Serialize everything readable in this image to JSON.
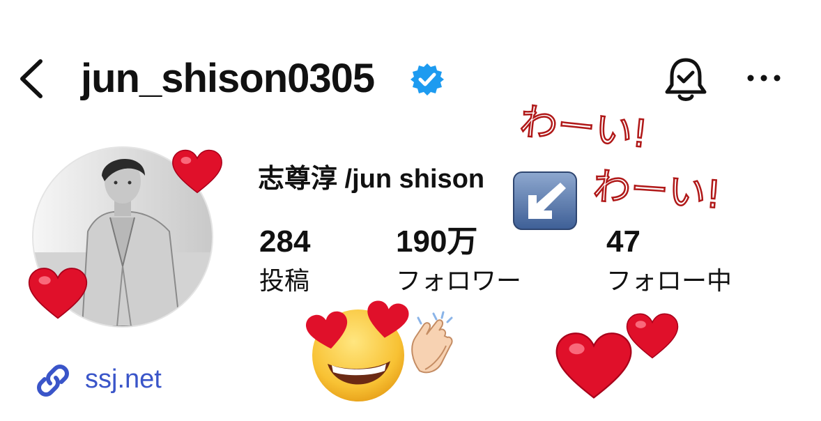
{
  "header": {
    "username": "jun_shison0305"
  },
  "profile": {
    "full_name": "志尊淳 /jun shison",
    "stats": {
      "posts": {
        "count": "284",
        "label": "投稿"
      },
      "followers": {
        "count": "190万",
        "label": "フォロワー"
      },
      "following": {
        "count": "47",
        "label": "フォロー中"
      }
    },
    "link": "ssj.net"
  },
  "decorations": {
    "handwritten": [
      "わーい!",
      "わーい!"
    ]
  },
  "colors": {
    "verified": "#1d9bf0",
    "link": "#3a55c9",
    "heart": "#e0102a",
    "scribble": "#b01818"
  }
}
